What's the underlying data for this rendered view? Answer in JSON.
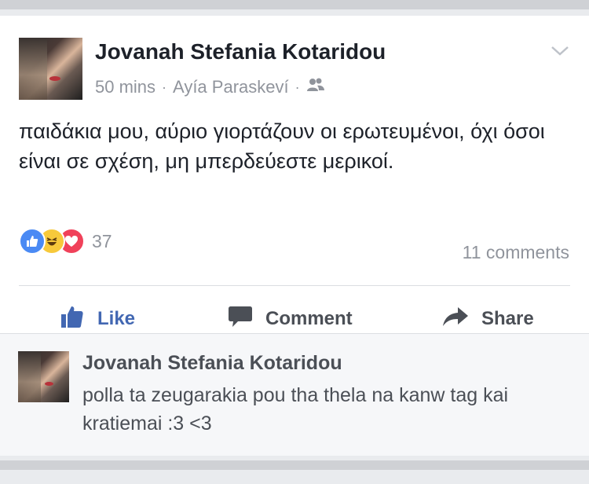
{
  "post": {
    "author": "Jovanah Stefania Kotaridou",
    "time": "50 mins",
    "separator": "·",
    "location": "Ayía Paraskeví",
    "audience_icon": "friends-icon",
    "text": "παιδάκια μου, αύριο γιορτάζουν οι ερωτευμένοι, όχι όσοι είναι σε σχέση, μη μπερδεύεστε μερικοί.",
    "reaction_count": "37",
    "comments_count": "11 comments"
  },
  "actions": {
    "like": "Like",
    "comment": "Comment",
    "share": "Share"
  },
  "comment": {
    "author": "Jovanah Stefania Kotaridou",
    "text": "polla ta zeugarakia pou tha thela na kanw tag kai kratiemai :3 <3"
  },
  "colors": {
    "like_blue": "#4267b2",
    "text_dark": "#1d2129",
    "meta_gray": "#90949c",
    "love_red": "#f0415a",
    "haha_yellow": "#f7c93b"
  }
}
